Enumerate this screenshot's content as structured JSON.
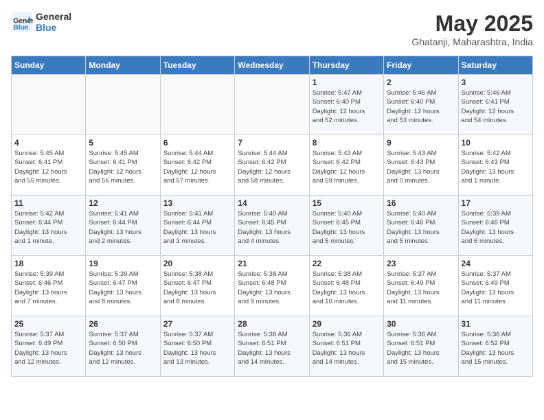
{
  "header": {
    "logo_line1": "General",
    "logo_line2": "Blue",
    "month_title": "May 2025",
    "location": "Ghatanji, Maharashtra, India"
  },
  "days_of_week": [
    "Sunday",
    "Monday",
    "Tuesday",
    "Wednesday",
    "Thursday",
    "Friday",
    "Saturday"
  ],
  "weeks": [
    [
      {
        "day": "",
        "info": ""
      },
      {
        "day": "",
        "info": ""
      },
      {
        "day": "",
        "info": ""
      },
      {
        "day": "",
        "info": ""
      },
      {
        "day": "1",
        "info": "Sunrise: 5:47 AM\nSunset: 6:40 PM\nDaylight: 12 hours\nand 52 minutes."
      },
      {
        "day": "2",
        "info": "Sunrise: 5:46 AM\nSunset: 6:40 PM\nDaylight: 12 hours\nand 53 minutes."
      },
      {
        "day": "3",
        "info": "Sunrise: 5:46 AM\nSunset: 6:41 PM\nDaylight: 12 hours\nand 54 minutes."
      }
    ],
    [
      {
        "day": "4",
        "info": "Sunrise: 5:45 AM\nSunset: 6:41 PM\nDaylight: 12 hours\nand 55 minutes."
      },
      {
        "day": "5",
        "info": "Sunrise: 5:45 AM\nSunset: 6:41 PM\nDaylight: 12 hours\nand 56 minutes."
      },
      {
        "day": "6",
        "info": "Sunrise: 5:44 AM\nSunset: 6:42 PM\nDaylight: 12 hours\nand 57 minutes."
      },
      {
        "day": "7",
        "info": "Sunrise: 5:44 AM\nSunset: 6:42 PM\nDaylight: 12 hours\nand 58 minutes."
      },
      {
        "day": "8",
        "info": "Sunrise: 5:43 AM\nSunset: 6:42 PM\nDaylight: 12 hours\nand 59 minutes."
      },
      {
        "day": "9",
        "info": "Sunrise: 5:43 AM\nSunset: 6:43 PM\nDaylight: 13 hours\nand 0 minutes."
      },
      {
        "day": "10",
        "info": "Sunrise: 5:42 AM\nSunset: 6:43 PM\nDaylight: 13 hours\nand 1 minute."
      }
    ],
    [
      {
        "day": "11",
        "info": "Sunrise: 5:42 AM\nSunset: 6:44 PM\nDaylight: 13 hours\nand 1 minute."
      },
      {
        "day": "12",
        "info": "Sunrise: 5:41 AM\nSunset: 6:44 PM\nDaylight: 13 hours\nand 2 minutes."
      },
      {
        "day": "13",
        "info": "Sunrise: 5:41 AM\nSunset: 6:44 PM\nDaylight: 13 hours\nand 3 minutes."
      },
      {
        "day": "14",
        "info": "Sunrise: 5:40 AM\nSunset: 6:45 PM\nDaylight: 13 hours\nand 4 minutes."
      },
      {
        "day": "15",
        "info": "Sunrise: 5:40 AM\nSunset: 6:45 PM\nDaylight: 13 hours\nand 5 minutes."
      },
      {
        "day": "16",
        "info": "Sunrise: 5:40 AM\nSunset: 6:46 PM\nDaylight: 13 hours\nand 5 minutes."
      },
      {
        "day": "17",
        "info": "Sunrise: 5:39 AM\nSunset: 6:46 PM\nDaylight: 13 hours\nand 6 minutes."
      }
    ],
    [
      {
        "day": "18",
        "info": "Sunrise: 5:39 AM\nSunset: 6:46 PM\nDaylight: 13 hours\nand 7 minutes."
      },
      {
        "day": "19",
        "info": "Sunrise: 5:39 AM\nSunset: 6:47 PM\nDaylight: 13 hours\nand 8 minutes."
      },
      {
        "day": "20",
        "info": "Sunrise: 5:38 AM\nSunset: 6:47 PM\nDaylight: 13 hours\nand 8 minutes."
      },
      {
        "day": "21",
        "info": "Sunrise: 5:38 AM\nSunset: 6:48 PM\nDaylight: 13 hours\nand 9 minutes."
      },
      {
        "day": "22",
        "info": "Sunrise: 5:38 AM\nSunset: 6:48 PM\nDaylight: 13 hours\nand 10 minutes."
      },
      {
        "day": "23",
        "info": "Sunrise: 5:37 AM\nSunset: 6:49 PM\nDaylight: 13 hours\nand 11 minutes."
      },
      {
        "day": "24",
        "info": "Sunrise: 5:37 AM\nSunset: 6:49 PM\nDaylight: 13 hours\nand 11 minutes."
      }
    ],
    [
      {
        "day": "25",
        "info": "Sunrise: 5:37 AM\nSunset: 6:49 PM\nDaylight: 13 hours\nand 12 minutes."
      },
      {
        "day": "26",
        "info": "Sunrise: 5:37 AM\nSunset: 6:50 PM\nDaylight: 13 hours\nand 12 minutes."
      },
      {
        "day": "27",
        "info": "Sunrise: 5:37 AM\nSunset: 6:50 PM\nDaylight: 13 hours\nand 13 minutes."
      },
      {
        "day": "28",
        "info": "Sunrise: 5:36 AM\nSunset: 6:51 PM\nDaylight: 13 hours\nand 14 minutes."
      },
      {
        "day": "29",
        "info": "Sunrise: 5:36 AM\nSunset: 6:51 PM\nDaylight: 13 hours\nand 14 minutes."
      },
      {
        "day": "30",
        "info": "Sunrise: 5:36 AM\nSunset: 6:51 PM\nDaylight: 13 hours\nand 15 minutes."
      },
      {
        "day": "31",
        "info": "Sunrise: 5:36 AM\nSunset: 6:52 PM\nDaylight: 13 hours\nand 15 minutes."
      }
    ]
  ]
}
